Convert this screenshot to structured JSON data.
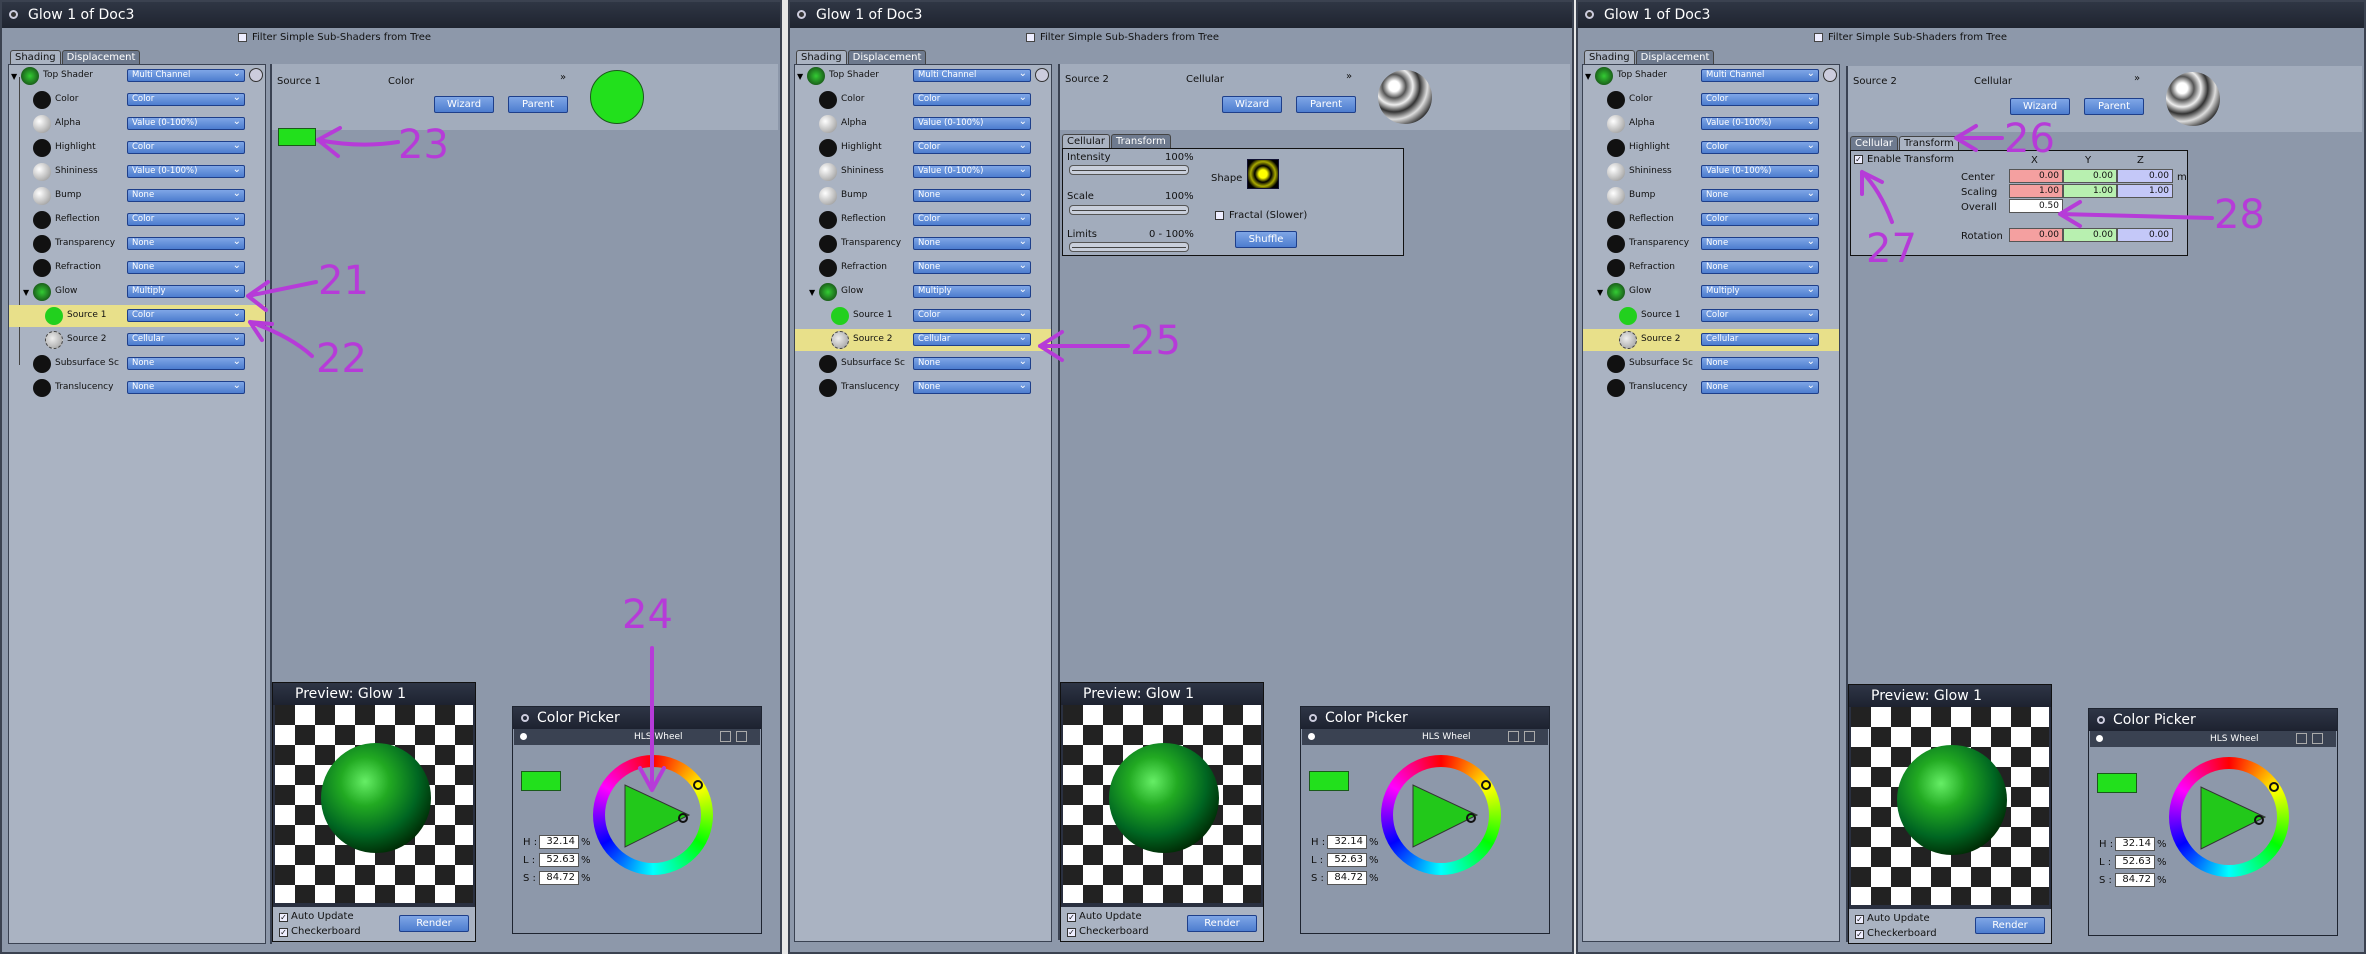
{
  "windows": [
    {
      "title": "Glow 1 of Doc3",
      "filter": "Filter Simple Sub-Shaders from Tree"
    },
    {
      "title": "Glow 1 of Doc3",
      "filter": "Filter Simple Sub-Shaders from Tree"
    },
    {
      "title": "Glow 1 of Doc3",
      "filter": "Filter Simple Sub-Shaders from Tree"
    }
  ],
  "tabs": {
    "shading": "Shading",
    "displacement": "Displacement",
    "cellular": "Cellular",
    "transform": "Transform"
  },
  "tree": [
    {
      "label": "Top Shader",
      "value": "Multi Channel"
    },
    {
      "label": "Color",
      "value": "Color"
    },
    {
      "label": "Alpha",
      "value": "Value (0-100%)"
    },
    {
      "label": "Highlight",
      "value": "Color"
    },
    {
      "label": "Shininess",
      "value": "Value (0-100%)"
    },
    {
      "label": "Bump",
      "value": "None"
    },
    {
      "label": "Reflection",
      "value": "Color"
    },
    {
      "label": "Transparency",
      "value": "None"
    },
    {
      "label": "Refraction",
      "value": "None"
    },
    {
      "label": "Glow",
      "value": "Multiply"
    },
    {
      "label": "Source 1",
      "value": "Color"
    },
    {
      "label": "Source 2",
      "value": "Cellular"
    },
    {
      "label": "Subsurface Sc",
      "value": "None"
    },
    {
      "label": "Translucency",
      "value": "None"
    }
  ],
  "panel1": {
    "source": "Source 1",
    "type": "Color"
  },
  "panel2": {
    "source": "Source 2",
    "type": "Cellular",
    "intensity_label": "Intensity",
    "intensity_val": "100%",
    "scale_label": "Scale",
    "scale_val": "100%",
    "limits_label": "Limits",
    "limits_val": "0 - 100%",
    "shape": "Shape",
    "fractal": "Fractal (Slower)",
    "shuffle": "Shuffle"
  },
  "panel3": {
    "source": "Source 2",
    "type": "Cellular",
    "enable": "Enable Transform",
    "x": "X",
    "y": "Y",
    "z": "Z",
    "center": "Center",
    "scaling": "Scaling",
    "overall": "Overall",
    "rotation": "Rotation",
    "unit": "m",
    "center_v": [
      "0.00",
      "0.00",
      "0.00"
    ],
    "scaling_v": [
      "1.00",
      "1.00",
      "1.00"
    ],
    "overall_v": "0.50",
    "rotation_v": [
      "0.00",
      "0.00",
      "0.00"
    ]
  },
  "buttons": {
    "wizard": "Wizard",
    "parent": "Parent",
    "render": "Render"
  },
  "preview": {
    "title": "Preview: Glow 1",
    "auto": "Auto Update",
    "checker": "Checkerboard"
  },
  "picker": {
    "title": "Color Picker",
    "mode": "HLS Wheel",
    "h_label": "H :",
    "l_label": "L :",
    "s_label": "S :",
    "h": "32.14",
    "l": "52.63",
    "s": "84.72",
    "pct": "%"
  },
  "annotations": [
    "21",
    "22",
    "23",
    "24",
    "25",
    "26",
    "27",
    "28"
  ],
  "colors": {
    "accent_green": "#22e01c",
    "annotation": "#b63bd8",
    "selected_row": "#e8e08a"
  }
}
